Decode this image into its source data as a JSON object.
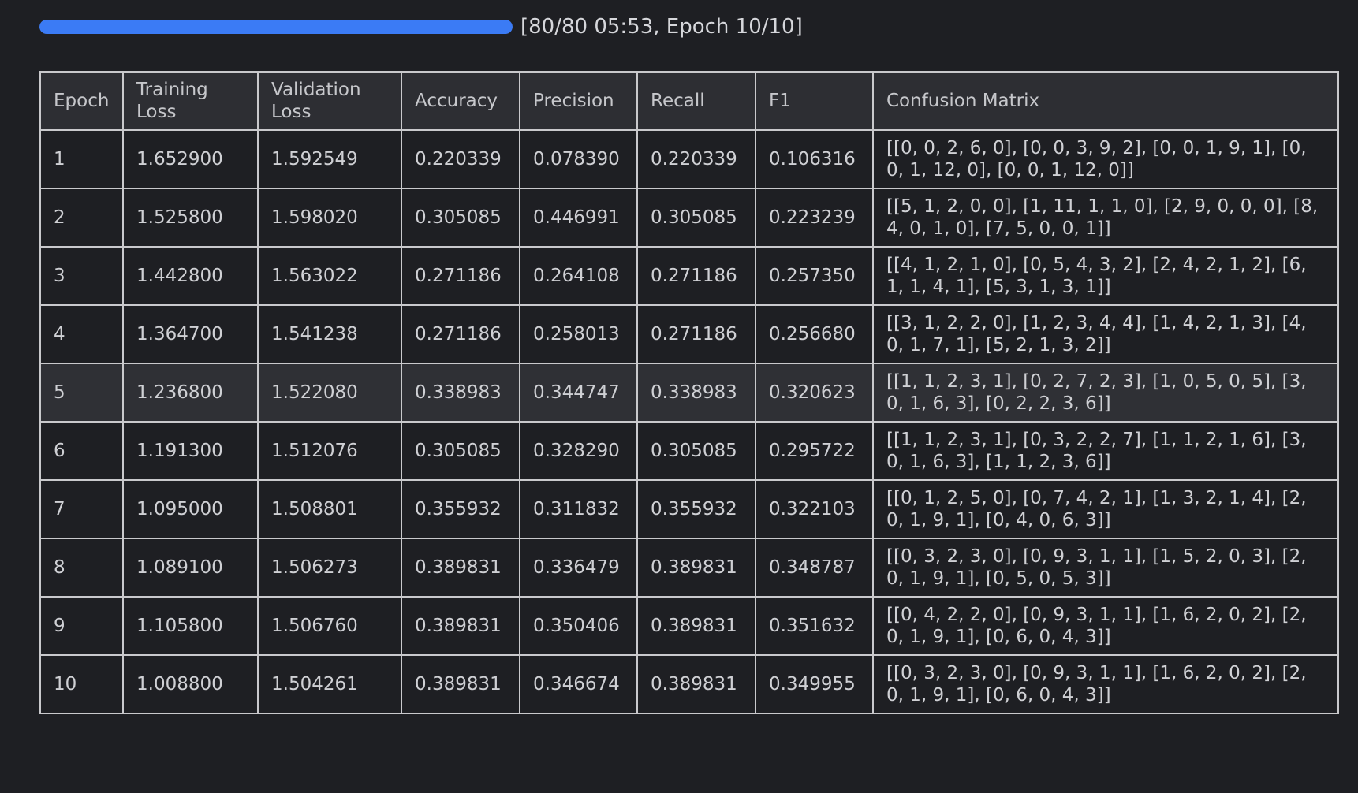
{
  "progress": {
    "fraction": 1.0,
    "text": "[80/80 05:53, Epoch 10/10]",
    "color": "#3b7bf5"
  },
  "table": {
    "headers": [
      "Epoch",
      "Training Loss",
      "Validation Loss",
      "Accuracy",
      "Precision",
      "Recall",
      "F1",
      "Confusion Matrix"
    ],
    "rows": [
      [
        "1",
        "1.652900",
        "1.592549",
        "0.220339",
        "0.078390",
        "0.220339",
        "0.106316",
        "[[0, 0, 2, 6, 0], [0, 0, 3, 9, 2], [0, 0, 1, 9, 1], [0, 0, 1, 12, 0], [0, 0, 1, 12, 0]]"
      ],
      [
        "2",
        "1.525800",
        "1.598020",
        "0.305085",
        "0.446991",
        "0.305085",
        "0.223239",
        "[[5, 1, 2, 0, 0], [1, 11, 1, 1, 0], [2, 9, 0, 0, 0], [8, 4, 0, 1, 0], [7, 5, 0, 0, 1]]"
      ],
      [
        "3",
        "1.442800",
        "1.563022",
        "0.271186",
        "0.264108",
        "0.271186",
        "0.257350",
        "[[4, 1, 2, 1, 0], [0, 5, 4, 3, 2], [2, 4, 2, 1, 2], [6, 1, 1, 4, 1], [5, 3, 1, 3, 1]]"
      ],
      [
        "4",
        "1.364700",
        "1.541238",
        "0.271186",
        "0.258013",
        "0.271186",
        "0.256680",
        "[[3, 1, 2, 2, 0], [1, 2, 3, 4, 4], [1, 4, 2, 1, 3], [4, 0, 1, 7, 1], [5, 2, 1, 3, 2]]"
      ],
      [
        "5",
        "1.236800",
        "1.522080",
        "0.338983",
        "0.344747",
        "0.338983",
        "0.320623",
        "[[1, 1, 2, 3, 1], [0, 2, 7, 2, 3], [1, 0, 5, 0, 5], [3, 0, 1, 6, 3], [0, 2, 2, 3, 6]]"
      ],
      [
        "6",
        "1.191300",
        "1.512076",
        "0.305085",
        "0.328290",
        "0.305085",
        "0.295722",
        "[[1, 1, 2, 3, 1], [0, 3, 2, 2, 7], [1, 1, 2, 1, 6], [3, 0, 1, 6, 3], [1, 1, 2, 3, 6]]"
      ],
      [
        "7",
        "1.095000",
        "1.508801",
        "0.355932",
        "0.311832",
        "0.355932",
        "0.322103",
        "[[0, 1, 2, 5, 0], [0, 7, 4, 2, 1], [1, 3, 2, 1, 4], [2, 0, 1, 9, 1], [0, 4, 0, 6, 3]]"
      ],
      [
        "8",
        "1.089100",
        "1.506273",
        "0.389831",
        "0.336479",
        "0.389831",
        "0.348787",
        "[[0, 3, 2, 3, 0], [0, 9, 3, 1, 1], [1, 5, 2, 0, 3], [2, 0, 1, 9, 1], [0, 5, 0, 5, 3]]"
      ],
      [
        "9",
        "1.105800",
        "1.506760",
        "0.389831",
        "0.350406",
        "0.389831",
        "0.351632",
        "[[0, 4, 2, 2, 0], [0, 9, 3, 1, 1], [1, 6, 2, 0, 2], [2, 0, 1, 9, 1], [0, 6, 0, 4, 3]]"
      ],
      [
        "10",
        "1.008800",
        "1.504261",
        "0.389831",
        "0.346674",
        "0.389831",
        "0.349955",
        "[[0, 3, 2, 3, 0], [0, 9, 3, 1, 1], [1, 6, 2, 0, 2], [2, 0, 1, 9, 1], [0, 6, 0, 4, 3]]"
      ]
    ],
    "highlighted_row": 4
  }
}
